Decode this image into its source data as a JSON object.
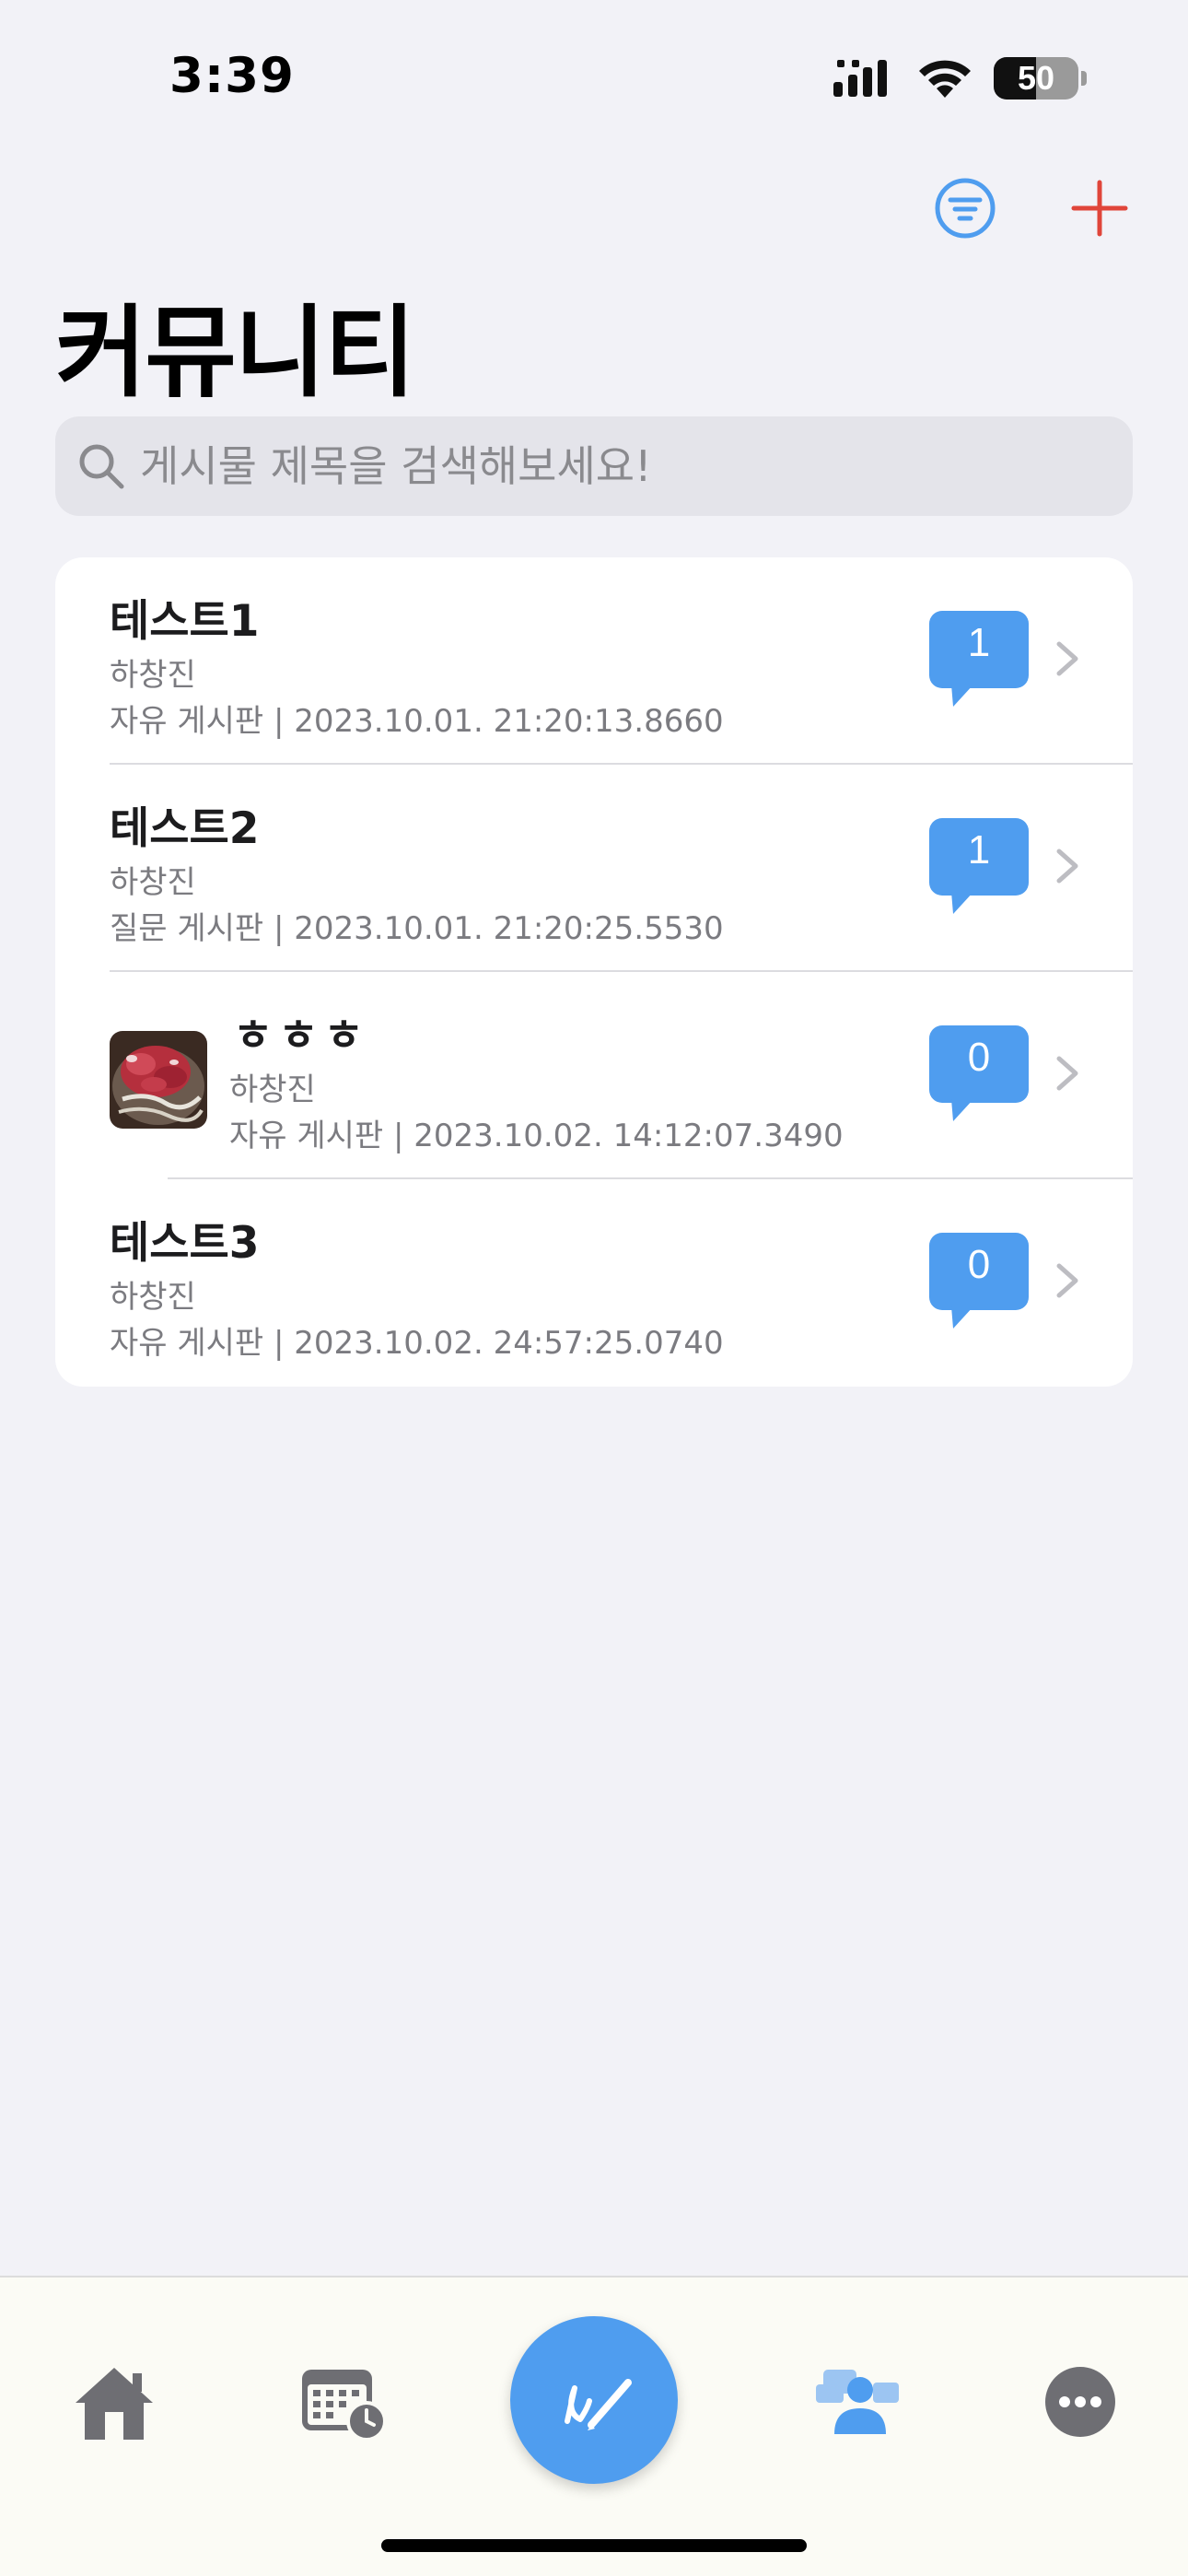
{
  "status_bar": {
    "time": "3:39",
    "battery_level": "50"
  },
  "header": {
    "title": "커뮤니티",
    "filter_icon": "filter-lines-icon",
    "add_icon": "plus-icon"
  },
  "search": {
    "placeholder": "게시물 제목을 검색해보세요!",
    "value": ""
  },
  "posts": [
    {
      "title": "테스트1",
      "author": "하창진",
      "meta": "자유 게시판 | 2023.10.01. 21:20:13.8660",
      "comments": "1",
      "has_image": false
    },
    {
      "title": "테스트2",
      "author": "하창진",
      "meta": "질문 게시판 | 2023.10.01. 21:20:25.5530",
      "comments": "1",
      "has_image": false
    },
    {
      "title": "ㅎㅎㅎ",
      "author": "하창진",
      "meta": "자유 게시판 | 2023.10.02. 14:12:07.3490",
      "comments": "0",
      "has_image": true
    },
    {
      "title": "테스트3",
      "author": "하창진",
      "meta": "자유 게시판 | 2023.10.02. 24:57:25.0740",
      "comments": "0",
      "has_image": false
    }
  ],
  "tab_bar": {
    "tabs": [
      "home-icon",
      "calendar-clock-icon",
      "compose-pen-icon",
      "community-people-icon",
      "more-ellipsis-icon"
    ],
    "active": "community-people-icon"
  },
  "colors": {
    "accent": "#4F9DEF",
    "add": "#E0453A",
    "background": "#F2F2F7"
  }
}
